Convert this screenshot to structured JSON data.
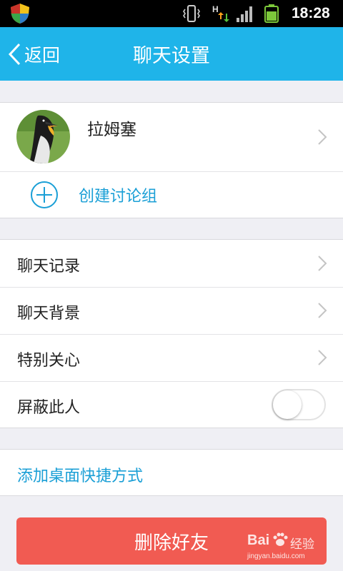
{
  "status_bar": {
    "time": "18:28",
    "icons": [
      "shield-icon",
      "vibrate-icon",
      "h-network-icon",
      "signal-icon",
      "battery-icon"
    ]
  },
  "header": {
    "back_label": "返回",
    "title": "聊天设置"
  },
  "contact": {
    "name": "拉姆塞"
  },
  "create_group": {
    "label": "创建讨论组"
  },
  "settings": {
    "items": [
      {
        "label": "聊天记录"
      },
      {
        "label": "聊天背景"
      },
      {
        "label": "特别关心"
      },
      {
        "label": "屏蔽此人"
      }
    ],
    "block_toggle_on": false
  },
  "shortcut": {
    "label": "添加桌面快捷方式"
  },
  "delete_button": {
    "label": "删除好友"
  },
  "watermark": {
    "brand": "Bai",
    "brand_cn": "经验",
    "site": "jingyan.baidu.com"
  },
  "colors": {
    "accent": "#1fb4e9",
    "link": "#1a9fd6",
    "danger": "#f15b52",
    "background": "#efeff4"
  }
}
